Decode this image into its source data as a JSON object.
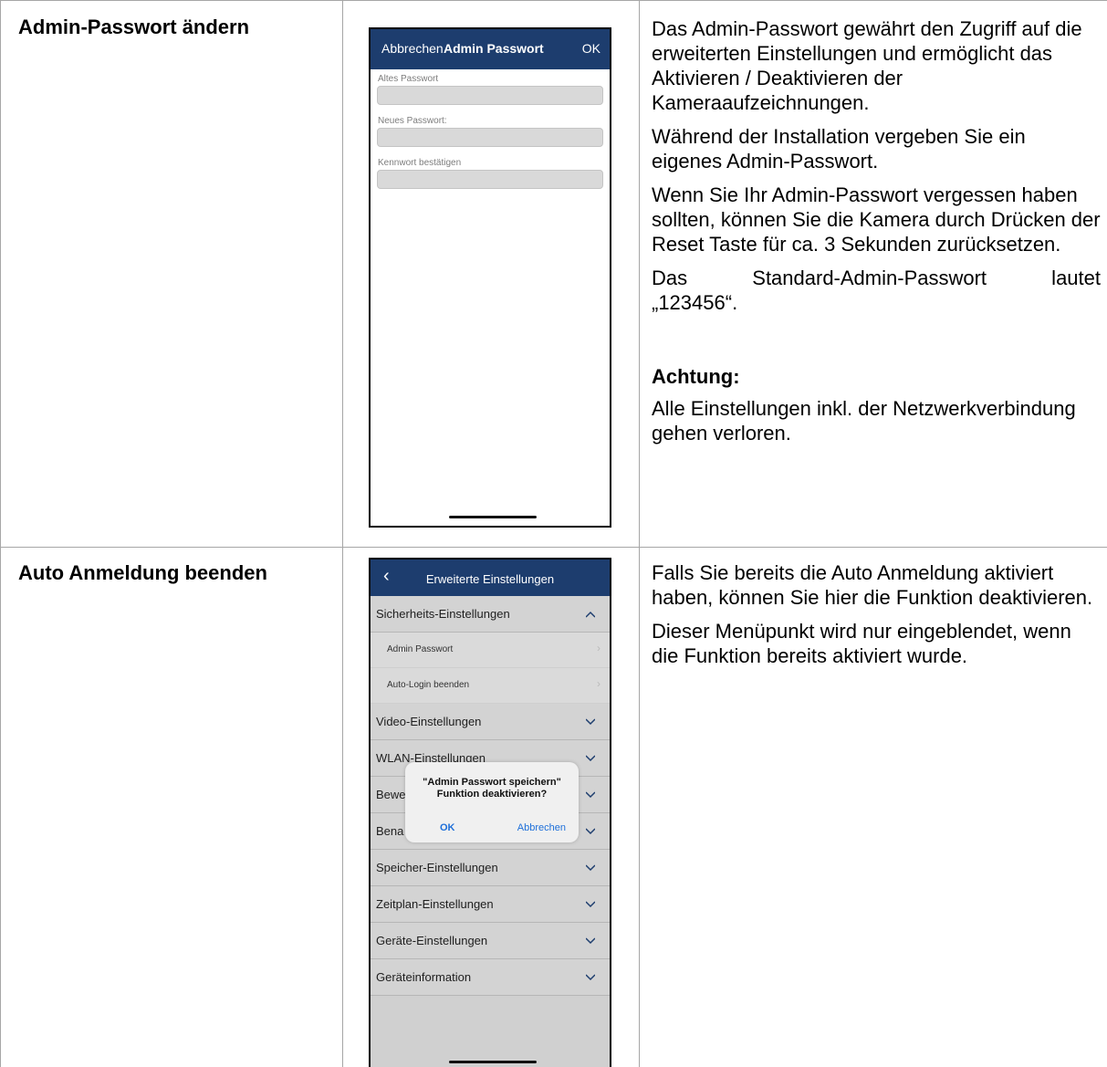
{
  "rows": [
    {
      "title": "Admin-Passwort ändern",
      "paragraphs": [
        "Das Admin-Passwort gewährt den Zugriff auf die erweiterten Einstellungen und ermöglicht das Aktivieren / Deaktivieren der Kameraaufzeichnungen.",
        "Während der Installation vergeben Sie ein eigenes Admin-Passwort.",
        "Wenn Sie Ihr Admin-Passwort vergessen haben sollten, können Sie die Kamera durch Drücken der Reset Taste für ca. 3 Sekunden zurücksetzen.",
        "Das Standard-Admin-Passwort lautet",
        "„123456“."
      ],
      "warning_heading": "Achtung:",
      "warning_text": "Alle Einstellungen inkl. der Netzwerkverbindung gehen verloren.",
      "phone": {
        "cancel": "Abbrechen",
        "title": "Admin Passwort",
        "ok": "OK",
        "fields": [
          "Altes Passwort",
          "Neues Passwort:",
          "Kennwort bestätigen"
        ]
      }
    },
    {
      "title": "Auto Anmeldung beenden",
      "paragraphs": [
        "Falls Sie bereits die Auto Anmeldung aktiviert haben, können Sie hier die Funktion deaktivieren.",
        "Dieser Menüpunkt wird nur eingeblendet, wenn die Funktion bereits aktiviert wurde."
      ],
      "phone": {
        "back": "‹",
        "title": "Erweiterte Einstellungen",
        "security_section": "Sicherheits-Einstellungen",
        "sub_items": [
          "Admin Passwort",
          "Auto-Login beenden"
        ],
        "sections": [
          "Video-Einstellungen",
          "WLAN-Einstellungen",
          "Bewe",
          "Bena",
          "Speicher-Einstellungen",
          "Zeitplan-Einstellungen",
          "Geräte-Einstellungen",
          "Geräteinformation"
        ],
        "dialog": {
          "line1": "\"Admin Passwort speichern\"",
          "line2": "Funktion deaktivieren?",
          "ok": "OK",
          "cancel": "Abbrechen"
        }
      }
    }
  ]
}
